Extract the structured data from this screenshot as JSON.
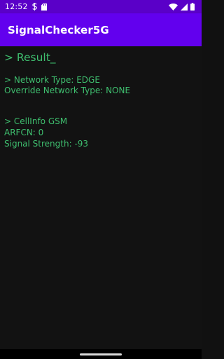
{
  "status_bar": {
    "time": "12:52",
    "icons": [
      "s-notification-icon",
      "sd-card-icon",
      "wifi-icon",
      "cell-signal-icon",
      "battery-icon"
    ],
    "color": "#5a00c8"
  },
  "app_bar": {
    "title": "SignalChecker5G",
    "color": "#6200ee"
  },
  "result": {
    "heading": "> Result_",
    "network_type": "> Network Type: EDGE",
    "override_network_type": "Override Network Type: NONE",
    "cellinfo_header": "> CellInfo GSM",
    "arfcn": "ARFCN: 0",
    "signal_strength": "Signal Strength: -93",
    "text_color": "#3fbf6f"
  }
}
